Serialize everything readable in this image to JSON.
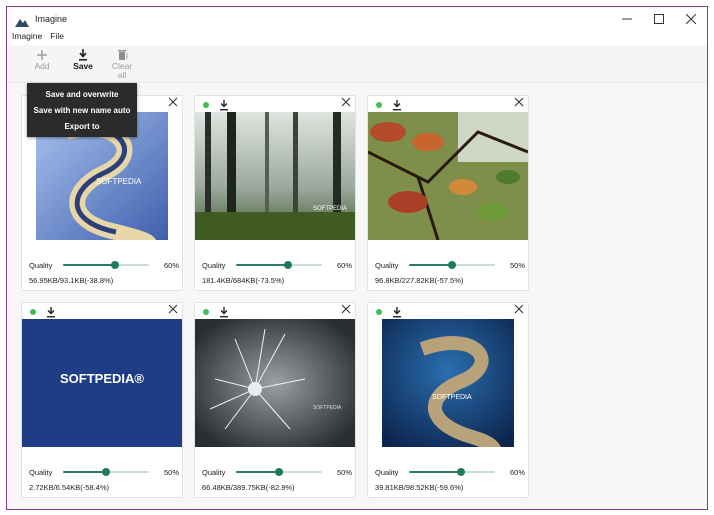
{
  "window": {
    "title": "Imagine"
  },
  "menu": {
    "items": [
      "Imagine",
      "File"
    ]
  },
  "toolbar": {
    "add_label": "Add",
    "save_label": "Save",
    "clear_label_1": "Clear",
    "clear_label_2": "all"
  },
  "save_menu": {
    "items": [
      "Save and overwrite",
      "Save with new name auto",
      "Export to"
    ]
  },
  "cards": [
    {
      "quality_label": "Quality",
      "quality": 60,
      "quality_text": "60%",
      "size": "56.95KB/93.1KB(-38.8%)",
      "image": "pixelated-s-logo",
      "watermark": "SOFTPEDIA"
    },
    {
      "quality_label": "Quality",
      "quality": 60,
      "quality_text": "60%",
      "size": "181.4KB/684KB(-73.5%)",
      "image": "misty-forest",
      "watermark": "SOFTPEDIA"
    },
    {
      "quality_label": "Quality",
      "quality": 50,
      "quality_text": "50%",
      "size": "96.8KB/227.82KB(-57.5%)",
      "image": "autumn-leaves",
      "watermark": ""
    },
    {
      "quality_label": "Quality",
      "quality": 50,
      "quality_text": "50%",
      "size": "2.72KB/6.54KB(-58.4%)",
      "image": "softpedia-logo",
      "watermark": "SOFTPEDIA®"
    },
    {
      "quality_label": "Quality",
      "quality": 50,
      "quality_text": "50%",
      "size": "66.48KB/389.75KB(-82.9%)",
      "image": "frosted-thistle",
      "watermark": "SOFTPEDIA"
    },
    {
      "quality_label": "Quality",
      "quality": 60,
      "quality_text": "60%",
      "size": "39.81KB/98.52KB(-59.6%)",
      "image": "s-island",
      "watermark": "SOFTPEDIA"
    }
  ],
  "colors": {
    "status_dot": "#3fbf4f",
    "slider_knob": "#1f7a62",
    "dark_menu": "#2b2b2b",
    "window_border": "#8a3a8a"
  }
}
